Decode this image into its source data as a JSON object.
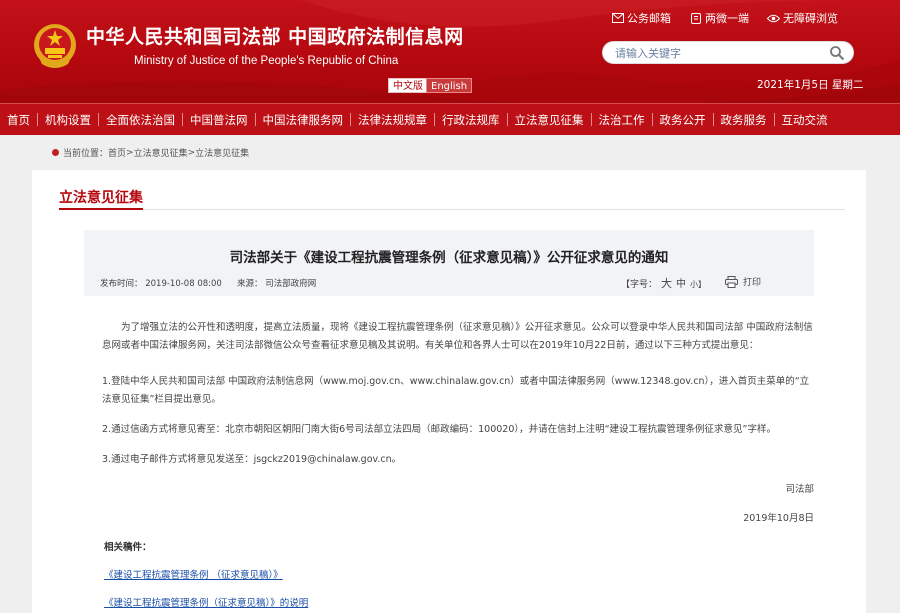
{
  "header": {
    "site_title": "中华人民共和国司法部  中国政府法制信息网",
    "site_subtitle": "Ministry of Justice of the People's Republic of China",
    "lang_cn": "中文版",
    "lang_en": "English",
    "top_links": {
      "mail": "公务邮箱",
      "weibo": "两微一端",
      "accessible": "无障碍浏览"
    },
    "search_placeholder": "请输入关键字",
    "date": "2021年1月5日 星期二"
  },
  "nav": {
    "items": [
      {
        "label": "首页"
      },
      {
        "label": "机构设置"
      },
      {
        "label": "全面依法治国"
      },
      {
        "label": "中国普法网"
      },
      {
        "label": "中国法律服务网"
      },
      {
        "label": "法律法规规章"
      },
      {
        "label": "行政法规库"
      },
      {
        "label": "立法意见征集"
      },
      {
        "label": "法治工作"
      },
      {
        "label": "政务公开"
      },
      {
        "label": "政务服务"
      },
      {
        "label": "互动交流"
      }
    ]
  },
  "breadcrumb": {
    "prefix": "当前位置：",
    "home": "首页",
    "sep": " > ",
    "level1": "立法意见征集",
    "level2": "立法意见征集"
  },
  "section": {
    "title": "立法意见征集"
  },
  "article": {
    "title": "司法部关于《建设工程抗震管理条例（征求意见稿）》公开征求意见的通知",
    "date_label": "发布时间：",
    "date_value": "2019-10-08 08:00",
    "source_label": "来源：",
    "source_value": "司法部政府网",
    "fontsize_label": "【字号：",
    "fontsize_large": "大",
    "fontsize_medium": "中",
    "fontsize_small": "小】",
    "print_label": "打印",
    "p1": "为了增强立法的公开性和透明度，提高立法质量，现将《建设工程抗震管理条例（征求意见稿）》公开征求意见。公众可以登录中华人民共和国司法部 中国政府法制信息网或者中国法律服务网，关注司法部微信公众号查看征求意见稿及其说明。有关单位和各界人士可以在2019年10月22日前，通过以下三种方式提出意见：",
    "p2": "1.登陆中华人民共和国司法部 中国政府法制信息网（www.moj.gov.cn、www.chinalaw.gov.cn）或者中国法律服务网（www.12348.gov.cn），进入首页主菜单的“立法意见征集”栏目提出意见。",
    "p3": "2.通过信函方式将意见寄至：北京市朝阳区朝阳门南大街6号司法部立法四局（邮政编码：100020），并请在信封上注明“建设工程抗震管理条例征求意见”字样。",
    "p4": "3.通过电子邮件方式将意见发送至：jsgckz2019@chinalaw.gov.cn。",
    "signature": "司法部",
    "signature_date": "2019年10月8日",
    "related_heading": "相关稿件：",
    "related_links": [
      {
        "label": "《建设工程抗震管理条例 （征求意见稿）》"
      },
      {
        "label": "《建设工程抗震管理条例（征求意见稿）》的说明"
      }
    ]
  },
  "colors": {
    "brand_red": "#b5080f",
    "link_blue": "#1a4fa8"
  }
}
